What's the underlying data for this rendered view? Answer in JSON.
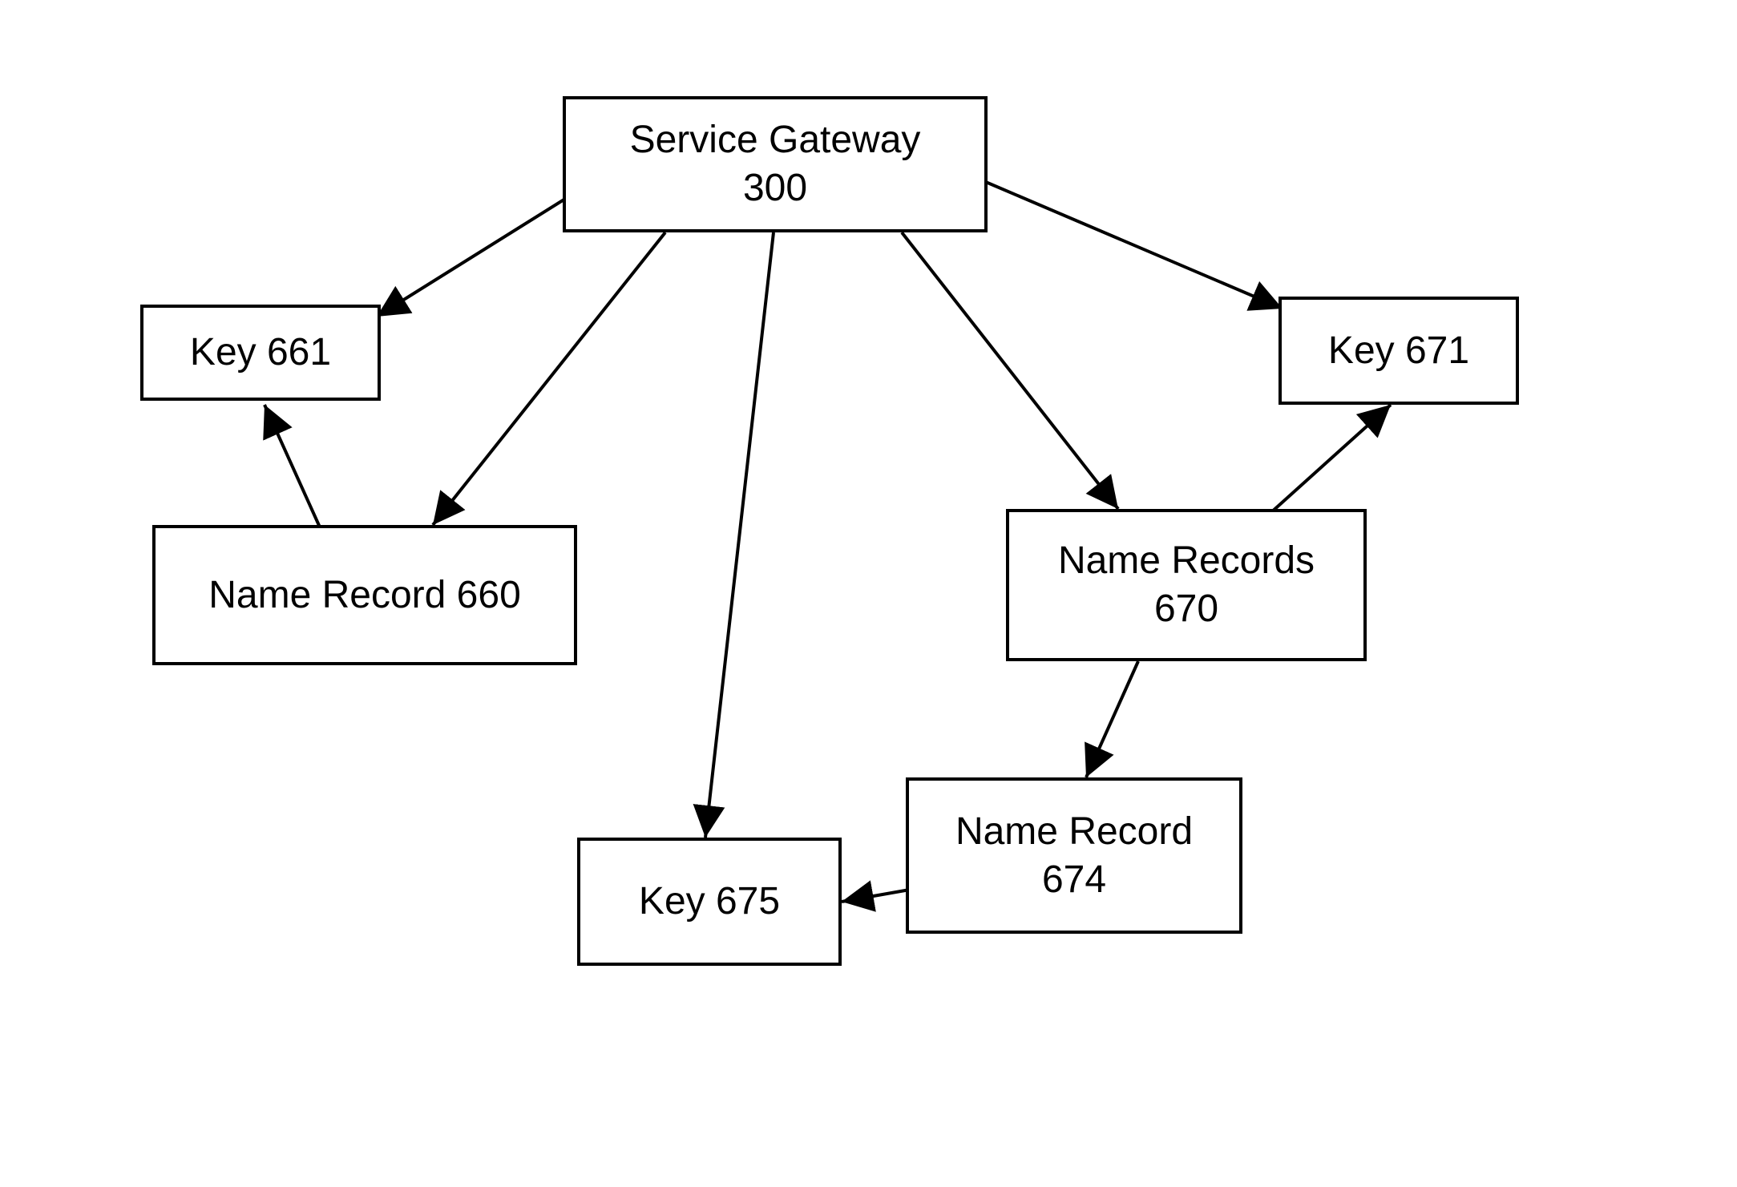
{
  "nodes": {
    "service_gateway": {
      "line1": "Service Gateway",
      "line2": "300"
    },
    "key_661": {
      "label": "Key 661"
    },
    "key_671": {
      "label": "Key 671"
    },
    "name_record_660": {
      "label": "Name Record 660"
    },
    "name_records_670": {
      "line1": "Name Records",
      "line2": "670"
    },
    "key_675": {
      "label": "Key 675"
    },
    "name_record_674": {
      "line1": "Name Record",
      "line2": "674"
    }
  }
}
